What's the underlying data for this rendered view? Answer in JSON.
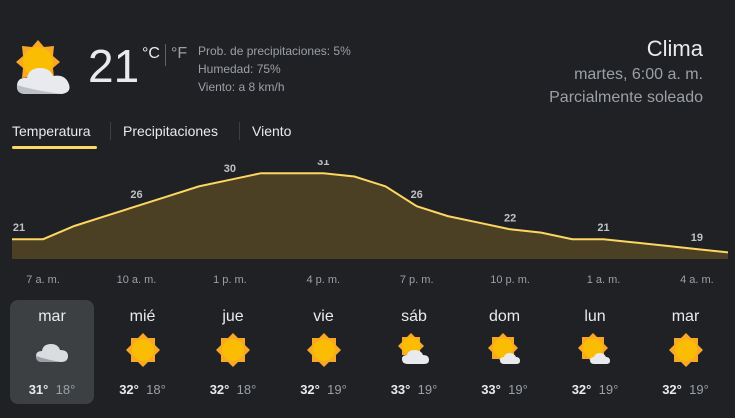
{
  "current": {
    "temp": "21",
    "unit_c": "°C",
    "unit_f": "°F",
    "precip": "Prob. de precipitaciones: 5%",
    "humidity": "Humedad: 75%",
    "wind": "Viento: a 8 km/h",
    "icon": "partly-cloudy-icon"
  },
  "header": {
    "title": "Clima",
    "datetime": "martes, 6:00 a. m.",
    "condition": "Parcialmente soleado"
  },
  "tabs": [
    {
      "label": "Temperatura",
      "active": true
    },
    {
      "label": "Precipitaciones",
      "active": false
    },
    {
      "label": "Viento",
      "active": false
    }
  ],
  "colors": {
    "accent": "#fdd663",
    "fill": "#4b4024",
    "sun": "#f9a825",
    "cloud": "#dadce0"
  },
  "chart_data": {
    "type": "area",
    "x": [
      "6 a. m.",
      "7 a. m.",
      "8 a. m.",
      "9 a. m.",
      "10 a. m.",
      "11 a. m.",
      "12 p. m.",
      "1 p. m.",
      "2 p. m.",
      "3 p. m.",
      "4 p. m.",
      "5 p. m.",
      "6 p. m.",
      "7 p. m.",
      "8 p. m.",
      "9 p. m.",
      "10 p. m.",
      "11 p. m.",
      "12 a. m.",
      "1 a. m.",
      "2 a. m.",
      "3 a. m.",
      "4 a. m.",
      "5 a. m."
    ],
    "values": [
      21,
      21,
      23,
      24.5,
      26,
      27.5,
      29,
      30,
      31,
      31,
      31,
      30.5,
      29,
      26,
      24.5,
      23.5,
      22.5,
      22,
      21,
      21,
      20.5,
      20,
      19.5,
      19
    ],
    "data_labels": [
      {
        "index": 0,
        "text": "21"
      },
      {
        "index": 4,
        "text": "26"
      },
      {
        "index": 7,
        "text": "30"
      },
      {
        "index": 10,
        "text": "31"
      },
      {
        "index": 13,
        "text": "26"
      },
      {
        "index": 16,
        "text": "22"
      },
      {
        "index": 19,
        "text": "21"
      },
      {
        "index": 22,
        "text": "19"
      }
    ],
    "tick_labels": [
      {
        "index": 1,
        "text": "7 a. m."
      },
      {
        "index": 4,
        "text": "10 a. m."
      },
      {
        "index": 7,
        "text": "1 p. m."
      },
      {
        "index": 10,
        "text": "4 p. m."
      },
      {
        "index": 13,
        "text": "7 p. m."
      },
      {
        "index": 16,
        "text": "10 p. m."
      },
      {
        "index": 19,
        "text": "1 a. m."
      },
      {
        "index": 22,
        "text": "4 a. m."
      }
    ],
    "ylim": [
      18,
      33
    ]
  },
  "days": [
    {
      "name": "mar",
      "hi": "31°",
      "lo": "18°",
      "icon": "cloudy-icon",
      "selected": true
    },
    {
      "name": "mié",
      "hi": "32°",
      "lo": "18°",
      "icon": "sun-icon",
      "selected": false
    },
    {
      "name": "jue",
      "hi": "32°",
      "lo": "18°",
      "icon": "sun-icon",
      "selected": false
    },
    {
      "name": "vie",
      "hi": "32°",
      "lo": "19°",
      "icon": "sun-icon",
      "selected": false
    },
    {
      "name": "sáb",
      "hi": "33°",
      "lo": "19°",
      "icon": "partly-cloudy-icon",
      "selected": false
    },
    {
      "name": "dom",
      "hi": "33°",
      "lo": "19°",
      "icon": "partly-cloudy-small-icon",
      "selected": false
    },
    {
      "name": "lun",
      "hi": "32°",
      "lo": "19°",
      "icon": "partly-cloudy-small-icon",
      "selected": false
    },
    {
      "name": "mar",
      "hi": "32°",
      "lo": "19°",
      "icon": "sun-icon",
      "selected": false
    }
  ]
}
